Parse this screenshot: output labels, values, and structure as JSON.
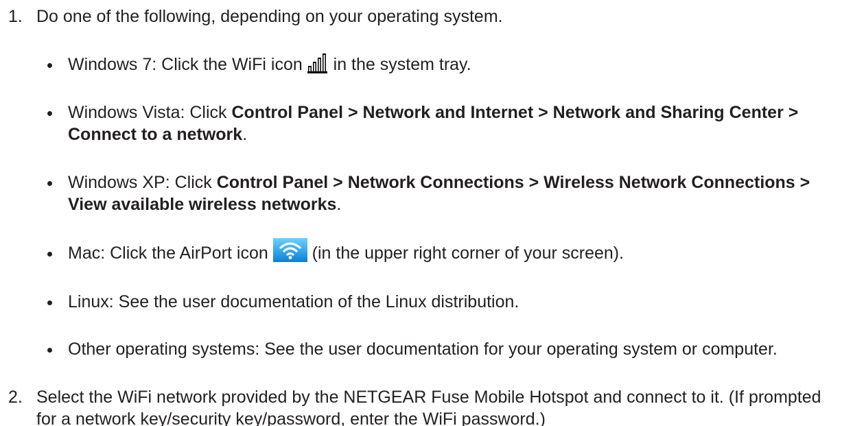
{
  "steps": [
    {
      "num": "1.",
      "text": "Do one of the following, depending on your operating system."
    },
    {
      "num": "2.",
      "text": "Select the WiFi network provided by the NETGEAR Fuse Mobile Hotspot and connect to it. (If prompted for a network key/security key/password, enter the WiFi password.)"
    }
  ],
  "bullets": {
    "win7": {
      "before": "Windows 7: Click the WiFi icon",
      "after": "in the system tray.",
      "icon": "signal-bars-icon"
    },
    "vista": {
      "before": "Windows Vista: Click",
      "bold": "Control Panel > Network and Internet > Network and Sharing Center > Connect to a network",
      "after": "."
    },
    "xp": {
      "before": "Windows XP: Click",
      "bold": "Control Panel > Network Connections > Wireless Network Connections > View available wireless networks",
      "after": "."
    },
    "mac": {
      "before": "Mac: Click the AirPort icon",
      "after": "(in the upper right corner of your screen).",
      "icon": "airport-wifi-icon",
      "icon_color": "#1e9fe6"
    },
    "linux": {
      "text": "Linux: See the user documentation of the Linux distribution."
    },
    "other": {
      "text": "Other operating systems: See the user documentation for your operating system or computer."
    }
  }
}
